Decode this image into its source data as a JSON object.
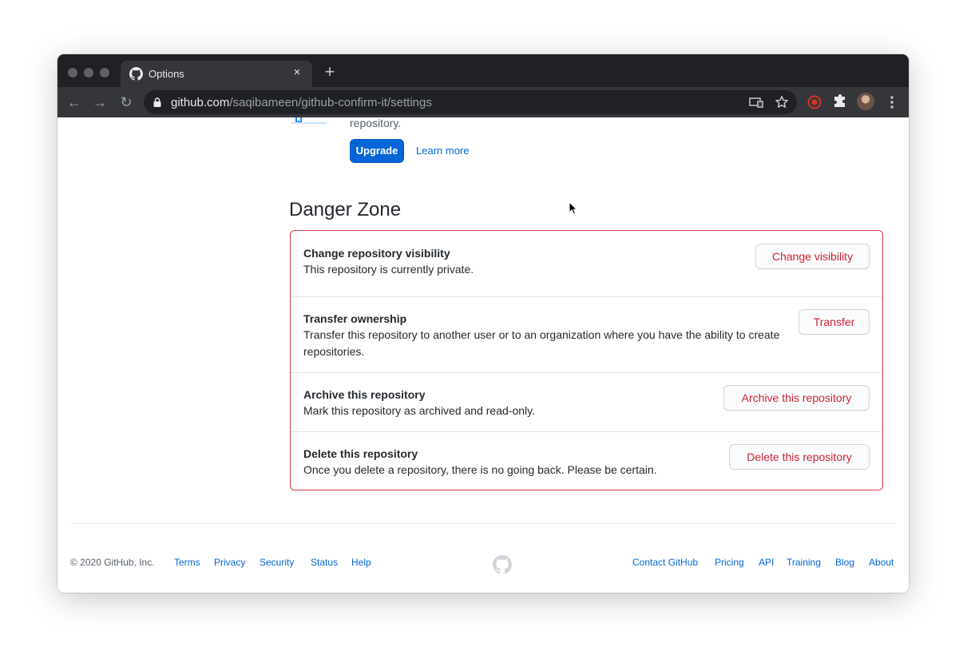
{
  "browser": {
    "tab_title": "Options",
    "tab_close": "×",
    "new_tab": "+",
    "url_host": "github.com",
    "url_path": "/saqibameen/github-confirm-it/settings",
    "nav": {
      "back": "←",
      "forward": "→",
      "reload": "↻"
    },
    "icons": [
      "github-icon",
      "lock-icon",
      "cast-icon",
      "star-icon",
      "extension-red-icon",
      "puzzle-icon",
      "avatar",
      "kebab-menu-icon"
    ]
  },
  "promo": {
    "text": "repository.",
    "upgrade_label": "Upgrade",
    "learn_more_label": "Learn more"
  },
  "danger_zone": {
    "title": "Danger Zone",
    "rows": [
      {
        "title": "Change repository visibility",
        "desc": "This repository is currently private.",
        "button": "Change visibility"
      },
      {
        "title": "Transfer ownership",
        "desc": "Transfer this repository to another user or to an organization where you have the ability to create repositories.",
        "button": "Transfer"
      },
      {
        "title": "Archive this repository",
        "desc": "Mark this repository as archived and read-only.",
        "button": "Archive this repository"
      },
      {
        "title": "Delete this repository",
        "desc": "Once you delete a repository, there is no going back. Please be certain.",
        "button": "Delete this repository"
      }
    ]
  },
  "footer": {
    "copyright": "© 2020 GitHub, Inc.",
    "left_links": [
      "Terms",
      "Privacy",
      "Security",
      "Status",
      "Help"
    ],
    "right_links": [
      "Contact GitHub",
      "Pricing",
      "API",
      "Training",
      "Blog",
      "About"
    ]
  },
  "colors": {
    "danger": "#d73a49",
    "danger_text": "#cb2431",
    "link": "#0366d6",
    "primary_button": "#0366d6",
    "chrome_dark": "#202124",
    "chrome_toolbar": "#35363a"
  }
}
